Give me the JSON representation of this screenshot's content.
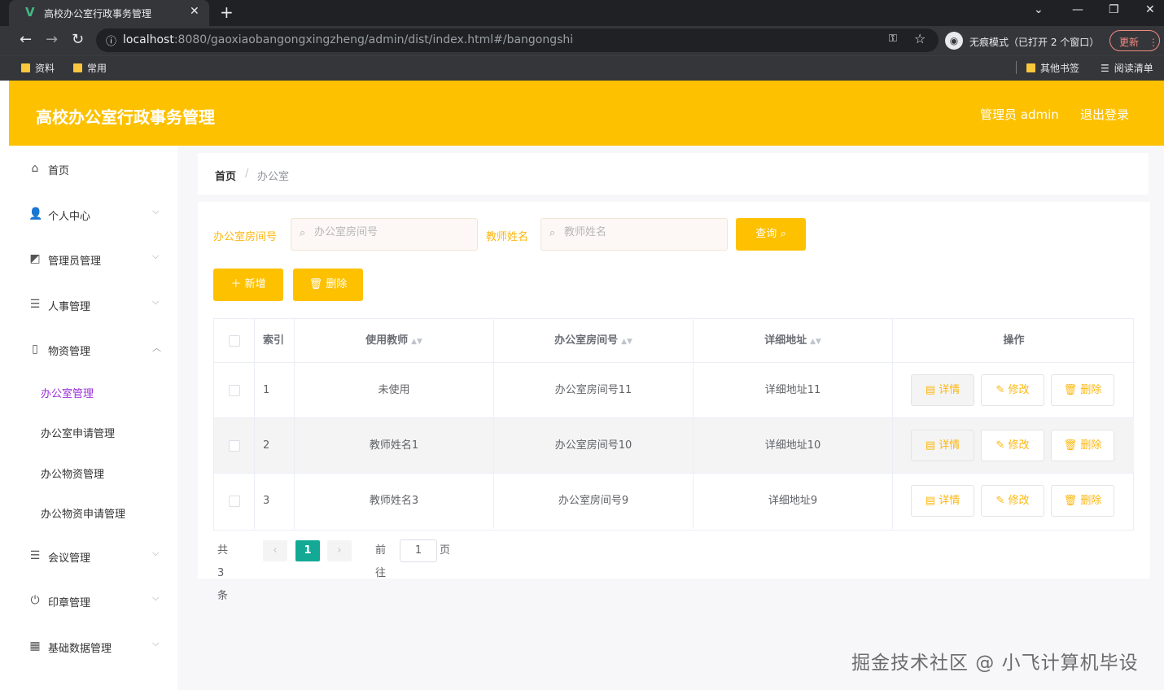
{
  "browser": {
    "tab_title": "高校办公室行政事务管理",
    "tab_favicon": "V",
    "url_host": "localhost",
    "url_rest": ":8080/gaoxiaobangongxingzheng/admin/dist/index.html#/bangongshi",
    "incognito_label": "无痕模式（已打开 2 个窗口）",
    "update_label": "更新",
    "bookmarks": [
      "资料",
      "常用"
    ],
    "other_bookmarks": "其他书签",
    "reading_list": "阅读清单"
  },
  "header": {
    "title": "高校办公室行政事务管理",
    "user": "管理员 admin",
    "logout": "退出登录",
    "color": "#fdc100"
  },
  "sidebar": {
    "items": [
      {
        "label": "首页",
        "icon": "home-icon"
      },
      {
        "label": "个人中心",
        "icon": "user-icon"
      },
      {
        "label": "管理员管理",
        "icon": "chart-icon"
      },
      {
        "label": "人事管理",
        "icon": "list-icon"
      },
      {
        "label": "物资管理",
        "icon": "phone-icon"
      },
      {
        "label": "会议管理",
        "icon": "list-icon"
      },
      {
        "label": "印章管理",
        "icon": "power-icon"
      },
      {
        "label": "基础数据管理",
        "icon": "grid-icon"
      }
    ],
    "submenu": [
      "办公室管理",
      "办公室申请管理",
      "办公物资管理",
      "办公物资申请管理"
    ],
    "active_color": "#9b30d9"
  },
  "breadcrumb": {
    "home": "首页",
    "sep": "/",
    "current": "办公室"
  },
  "filters": {
    "room_label": "办公室房间号",
    "room_placeholder": "办公室房间号",
    "teacher_label": "教师姓名",
    "teacher_placeholder": "教师姓名",
    "query_label": "查询"
  },
  "actions": {
    "add_label": "新增",
    "delete_label": "删除"
  },
  "table": {
    "headers": [
      "索引",
      "使用教师",
      "办公室房间号",
      "详细地址",
      "操作"
    ],
    "rows": [
      {
        "index": "1",
        "teacher": "未使用",
        "room": "办公室房间号11",
        "address": "详细地址11"
      },
      {
        "index": "2",
        "teacher": "教师姓名1",
        "room": "办公室房间号10",
        "address": "详细地址10"
      },
      {
        "index": "3",
        "teacher": "教师姓名3",
        "room": "办公室房间号9",
        "address": "详细地址9"
      }
    ],
    "op_detail": "详情",
    "op_edit": "修改",
    "op_delete": "删除"
  },
  "pagination": {
    "total_text": "共 3 条",
    "current_page": "1",
    "goto_label": "前往",
    "goto_value": "1",
    "page_suffix": "页",
    "active_color": "#13a994"
  },
  "watermark": "掘金技术社区 @ 小飞计算机毕设"
}
